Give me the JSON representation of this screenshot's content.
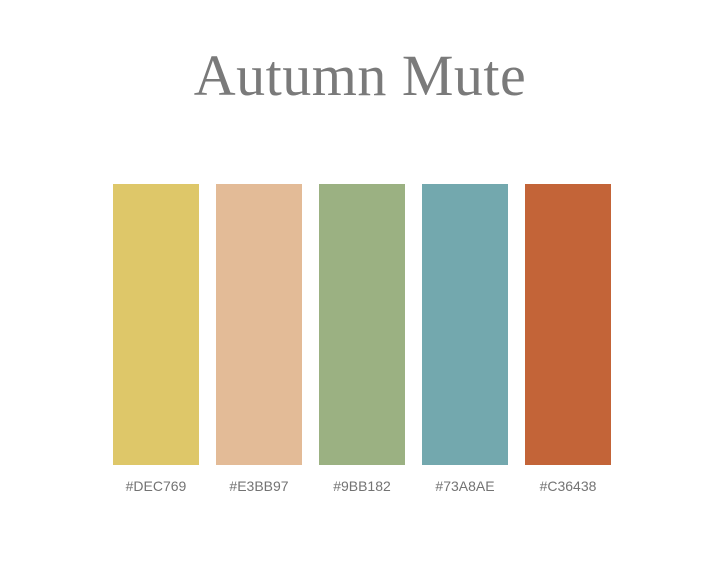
{
  "title": "Autumn Mute",
  "swatches": [
    {
      "label": "#DEC769",
      "color": "#DEC769"
    },
    {
      "label": "#E3BB97",
      "color": "#E3BB97"
    },
    {
      "label": "#9BB182",
      "color": "#9BB182"
    },
    {
      "label": "#73A8AE",
      "color": "#73A8AE"
    },
    {
      "label": "#C36438",
      "color": "#C36438"
    }
  ]
}
